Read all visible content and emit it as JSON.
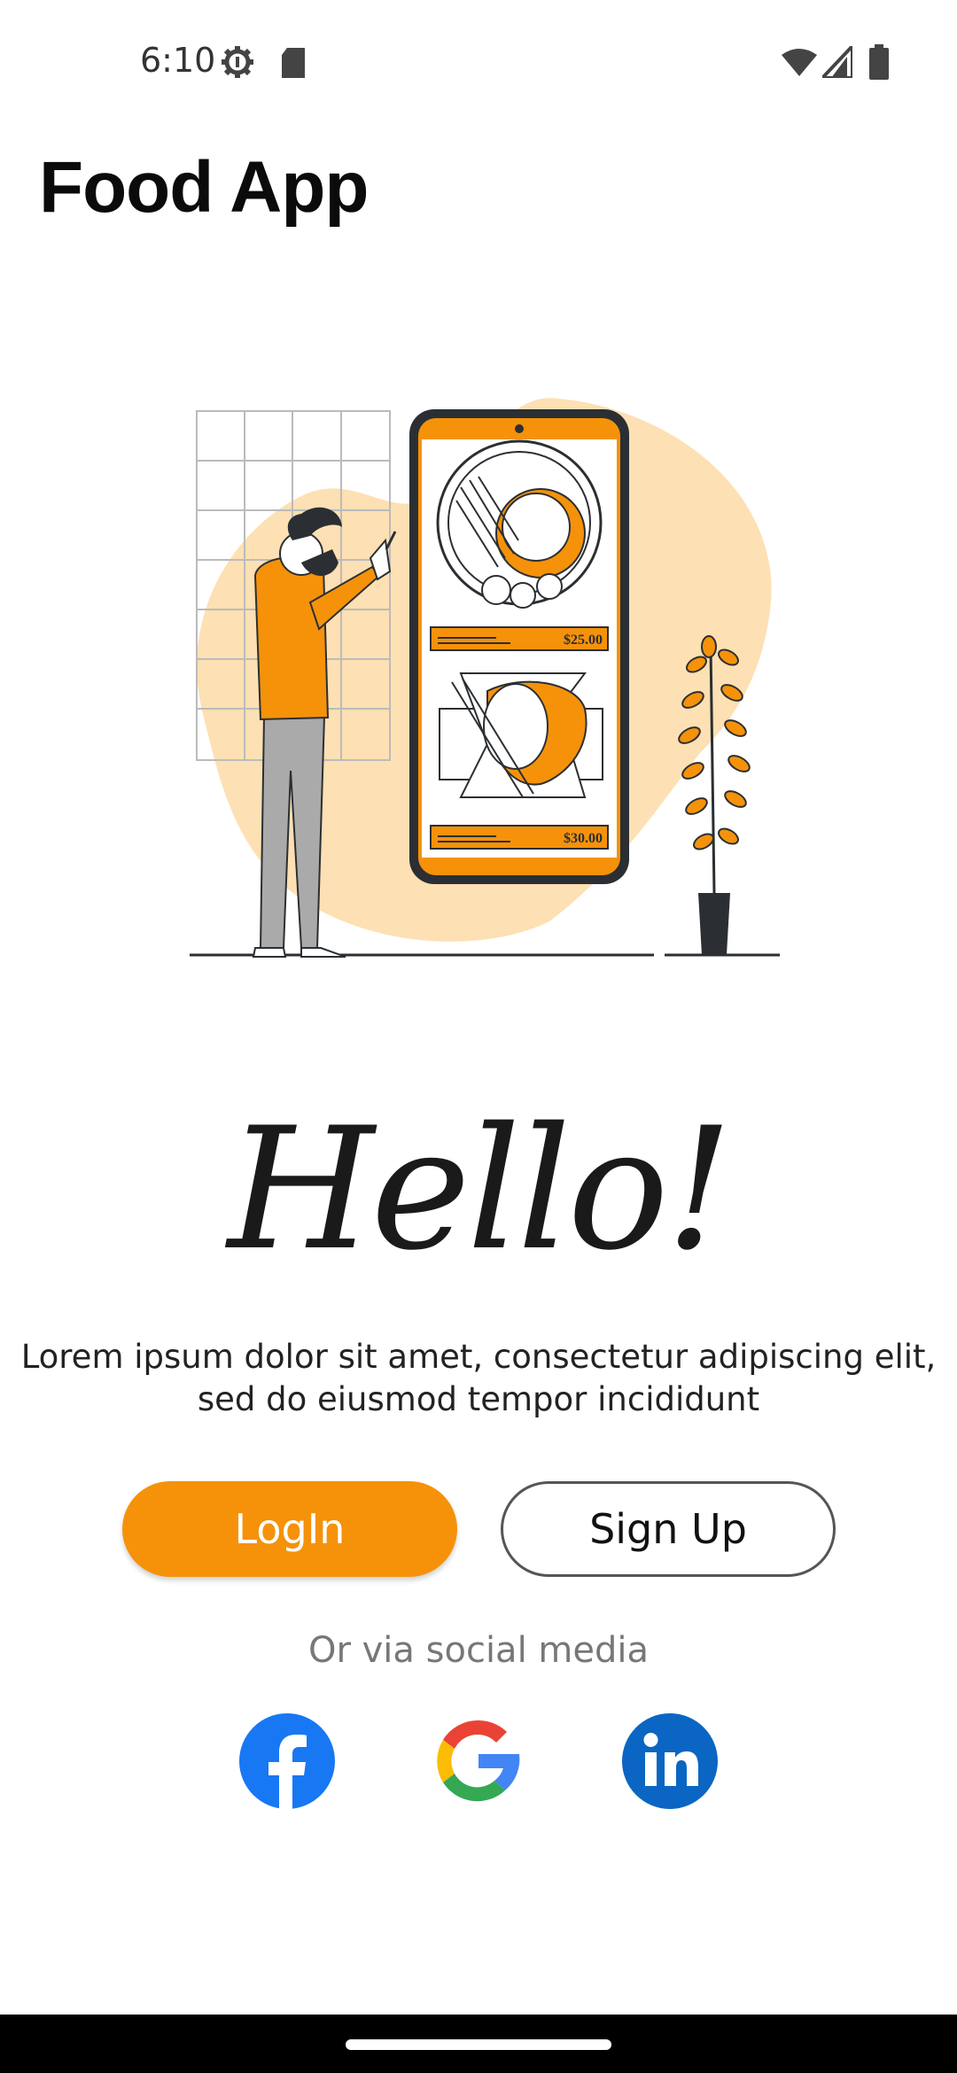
{
  "status_bar": {
    "time": "6:10",
    "icons": [
      "settings-icon",
      "sd-card-icon",
      "wifi-icon",
      "cell-signal-icon",
      "battery-icon"
    ]
  },
  "app": {
    "title": "Food App"
  },
  "hero": {
    "prices": [
      "$25.00",
      "$30.00"
    ],
    "colors": {
      "accent": "#f5920a",
      "blob": "#fde0b3",
      "outline": "#2b2f33"
    }
  },
  "greeting": "Hello!",
  "description": {
    "line1": "Lorem ipsum dolor sit amet, consectetur adipiscing elit,",
    "line2": "sed do eiusmod tempor incididunt"
  },
  "buttons": {
    "login": "LogIn",
    "signup": "Sign Up"
  },
  "social": {
    "label": "Or via social media",
    "items": [
      {
        "name": "facebook-icon",
        "color": "#1877f2"
      },
      {
        "name": "google-icon",
        "color": "#4285f4"
      },
      {
        "name": "linkedin-icon",
        "color": "#0a66c2"
      }
    ]
  }
}
